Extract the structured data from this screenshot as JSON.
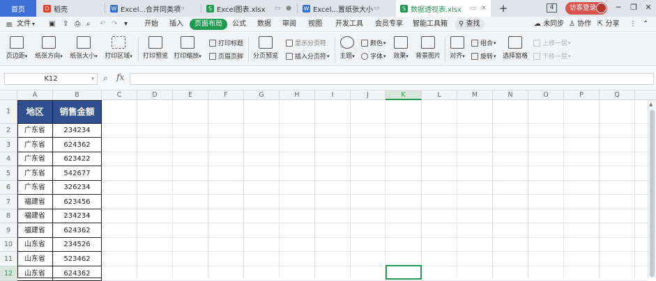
{
  "tabs": [
    {
      "label": "首页",
      "icon": ""
    },
    {
      "label": "稻壳",
      "icon": "daoke-icon"
    },
    {
      "label": "Excel...合并同类项",
      "icon": "wps-writer-icon"
    },
    {
      "label": "Excel图表.xlsx",
      "icon": "wps-sheet-icon"
    },
    {
      "label": "Excel...置纸张大小",
      "icon": "wps-writer-icon"
    },
    {
      "label": "数据透视表.xlsx",
      "icon": "wps-sheet-icon"
    }
  ],
  "window": {
    "tab_count": "4",
    "login_label": "访客登录"
  },
  "menu": {
    "file_label": "文件",
    "items": [
      "开始",
      "插入",
      "页面布局",
      "公式",
      "数据",
      "审阅",
      "视图",
      "开发工具",
      "会员专享",
      "智能工具箱"
    ],
    "active": "页面布局",
    "search_label": "查找",
    "sync_label": "未同步",
    "collab_label": "协作",
    "share_label": "分享"
  },
  "ribbon": {
    "big": [
      "页边距",
      "纸张方向",
      "纸张大小",
      "打印区域",
      "打印预览",
      "打印缩放",
      "分页预览",
      "主题",
      "背景图片",
      "对齐",
      "选择窗格"
    ],
    "small": {
      "print_title": "打印标题",
      "header_footer": "页眉页脚",
      "show_page_break": "显示分页符",
      "insert_page_break": "插入分页符",
      "color": "颜色",
      "font": "字体",
      "effect": "效果",
      "group": "组合",
      "rotate": "旋转",
      "up_layer": "上移一层",
      "down_layer": "下移一层"
    }
  },
  "formula_bar": {
    "name_box": "K12",
    "formula": ""
  },
  "columns": [
    "A",
    "B",
    "C",
    "D",
    "E",
    "F",
    "G",
    "H",
    "I",
    "J",
    "K",
    "L",
    "M",
    "N",
    "O",
    "P",
    "Q"
  ],
  "selected_column": "K",
  "rows": [
    "1",
    "2",
    "3",
    "4",
    "5",
    "6",
    "7",
    "8",
    "9",
    "10",
    "11",
    "12"
  ],
  "selected_row": "12",
  "table": {
    "headers": [
      "地区",
      "销售金额"
    ],
    "rows": [
      [
        "广东省",
        "234234"
      ],
      [
        "广东省",
        "624362"
      ],
      [
        "广东省",
        "623422"
      ],
      [
        "广东省",
        "542677"
      ],
      [
        "广东省",
        "326234"
      ],
      [
        "福建省",
        "623456"
      ],
      [
        "福建省",
        "234234"
      ],
      [
        "福建省",
        "624362"
      ],
      [
        "山东省",
        "234526"
      ],
      [
        "山东省",
        "523462"
      ],
      [
        "山东省",
        "624362"
      ]
    ]
  },
  "colors": {
    "accent": "#1f9a51",
    "table_header_bg": "#2f4f8f",
    "login_bg": "#d9534f"
  }
}
